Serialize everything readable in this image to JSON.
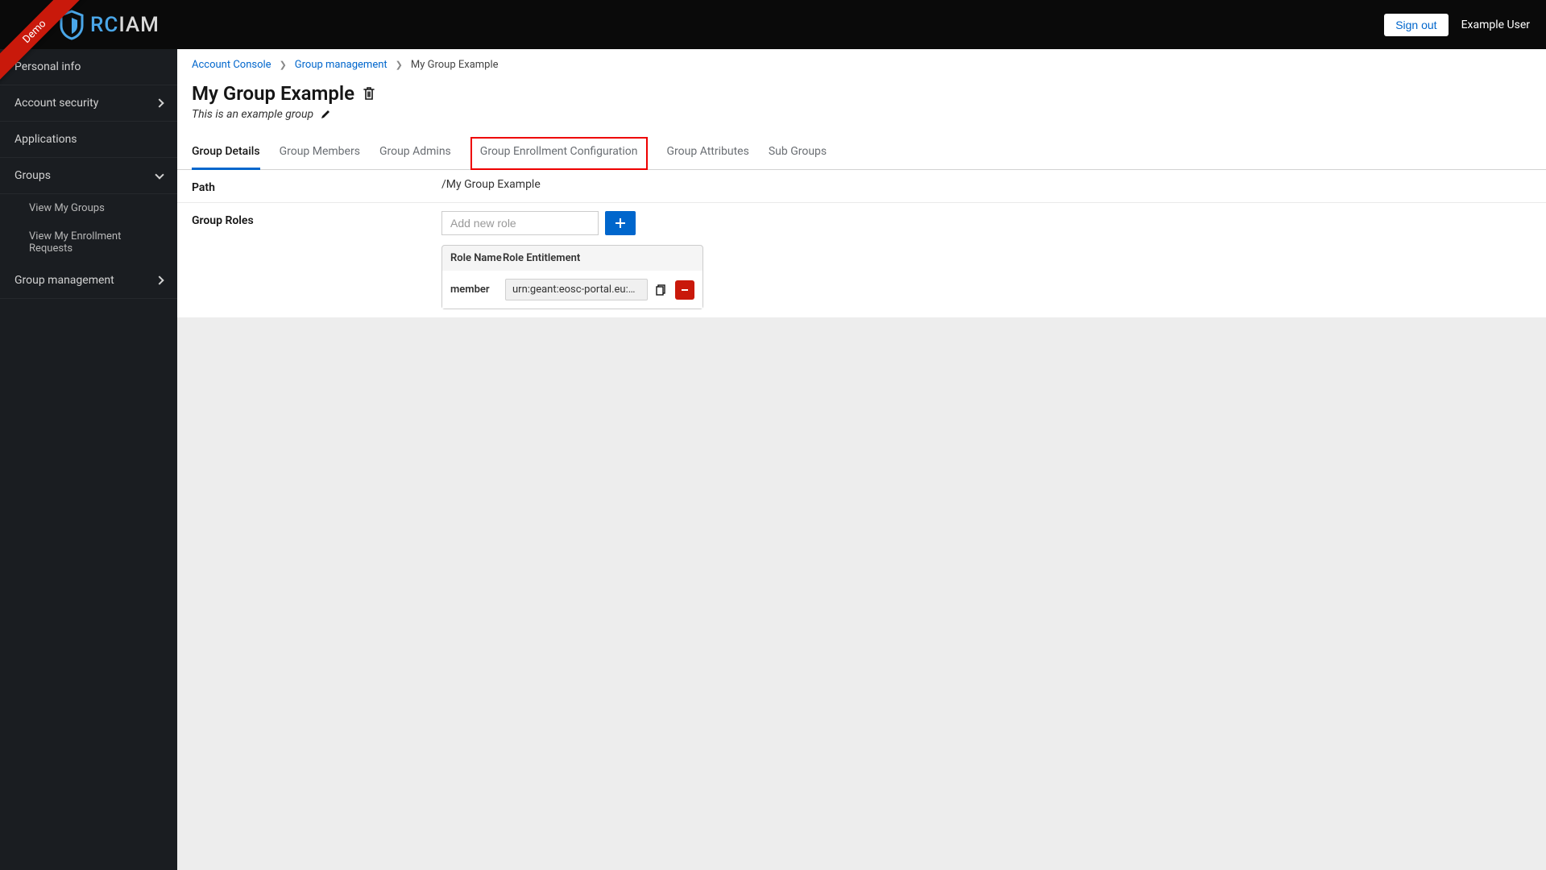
{
  "header": {
    "brand_rc": "RC",
    "brand_iam": "IAM",
    "demo_label": "Demo",
    "signout_label": "Sign out",
    "user_label": "Example User"
  },
  "sidebar": {
    "items": [
      {
        "label": "Personal info"
      },
      {
        "label": "Account security"
      },
      {
        "label": "Applications"
      },
      {
        "label": "Groups"
      },
      {
        "label": "View My Groups"
      },
      {
        "label": "View My Enrollment Requests"
      },
      {
        "label": "Group management"
      }
    ]
  },
  "breadcrumbs": {
    "account_console": "Account Console",
    "group_management": "Group management",
    "current": "My Group Example"
  },
  "page": {
    "title": "My Group Example",
    "description": "This is an example group"
  },
  "tabs": [
    {
      "label": "Group Details"
    },
    {
      "label": "Group Members"
    },
    {
      "label": "Group Admins"
    },
    {
      "label": "Group Enrollment Configuration"
    },
    {
      "label": "Group Attributes"
    },
    {
      "label": "Sub Groups"
    }
  ],
  "details": {
    "path_label": "Path",
    "path_value": "/My Group Example",
    "roles_label": "Group Roles",
    "add_role_placeholder": "Add new role",
    "table_head_name": "Role Name",
    "table_head_ent": "Role Entitlement",
    "rows": [
      {
        "name": "member",
        "entitlement": "urn:geant:eosc-portal.eu:grou …"
      }
    ]
  }
}
